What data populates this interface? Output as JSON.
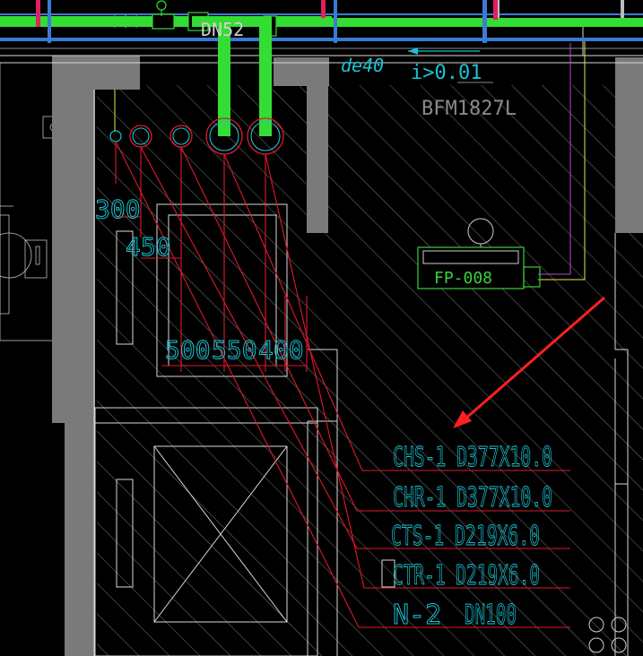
{
  "colors": {
    "background": "#000000",
    "hatch": "#8a8a8a",
    "wall": "#7a7a7a",
    "outline": "#d0d0d0",
    "green_pipe": "#33dd33",
    "blue_pipe": "#3a7bd5",
    "cyan_text": "#19c3d3",
    "red_leader": "#e0192b",
    "yellow_line": "#e8e84a",
    "magenta_line": "#b04bd0",
    "arrow": "#ff2020",
    "grey_text": "#a0a0a0",
    "unit_green": "#39d039"
  },
  "top_labels": {
    "pipe_ref": "DN52",
    "pipe_size": "de40",
    "slope": "i>0.01",
    "beam": "BFM1827L"
  },
  "dimensions": {
    "d1": "300",
    "d2": "450",
    "d3": "500",
    "d4": "550",
    "d5": "400"
  },
  "equipment": {
    "tag": "FP-008"
  },
  "pipe_labels": [
    {
      "id": "CHS-1",
      "spec": "D377X10.0"
    },
    {
      "id": "CHR-1",
      "spec": "D377X10.0"
    },
    {
      "id": "CTS-1",
      "spec": "D219X6.0"
    },
    {
      "id": "CTR-1",
      "spec": "D219X6.0"
    },
    {
      "id": "N-2",
      "spec": "DN100"
    }
  ]
}
